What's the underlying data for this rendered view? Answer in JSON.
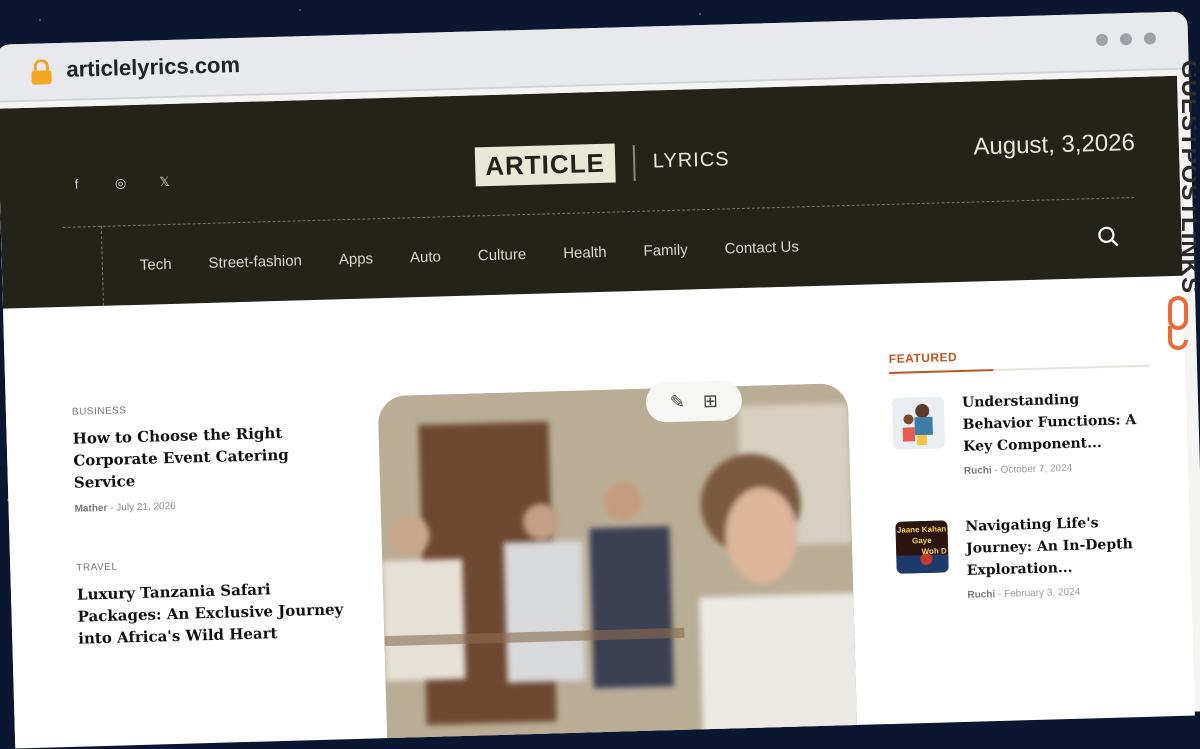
{
  "browser": {
    "url": "articlelyrics.com"
  },
  "header": {
    "logo_left": "ARTICLE",
    "logo_right": "LYRICS",
    "date": "August, 3,2026",
    "social": [
      {
        "icon": "facebook-icon",
        "glyph": "f"
      },
      {
        "icon": "instagram-icon",
        "glyph": "◎"
      },
      {
        "icon": "x-icon",
        "glyph": "𝕏"
      }
    ]
  },
  "nav": [
    "Tech",
    "Street-fashion",
    "Apps",
    "Auto",
    "Culture",
    "Health",
    "Family",
    "Contact Us"
  ],
  "posts": [
    {
      "category": "BUSINESS",
      "title": "How to Choose the Right Corporate Event Catering Service",
      "author": "Mather",
      "date": "July 21, 2026"
    },
    {
      "category": "TRAVEL",
      "title": "Luxury Tanzania Safari Packages: An Exclusive Journey into Africa's Wild Heart",
      "author": "",
      "date": ""
    }
  ],
  "featured": {
    "label": "FEATURED",
    "items": [
      {
        "title": "Understanding Behavior Functions: A Key Component...",
        "author": "Ruchi",
        "date": "October 7, 2024"
      },
      {
        "title": "Navigating Life's Journey: An In-Depth Exploration...",
        "author": "Ruchi",
        "date": "February 3, 2024",
        "thumb_text": "Jaane Kahan Gaye Woh D"
      }
    ]
  },
  "watermark": "GUESTPOSTLINKS",
  "colors": {
    "header_bg": "#23231a",
    "accent": "#c2541e"
  }
}
